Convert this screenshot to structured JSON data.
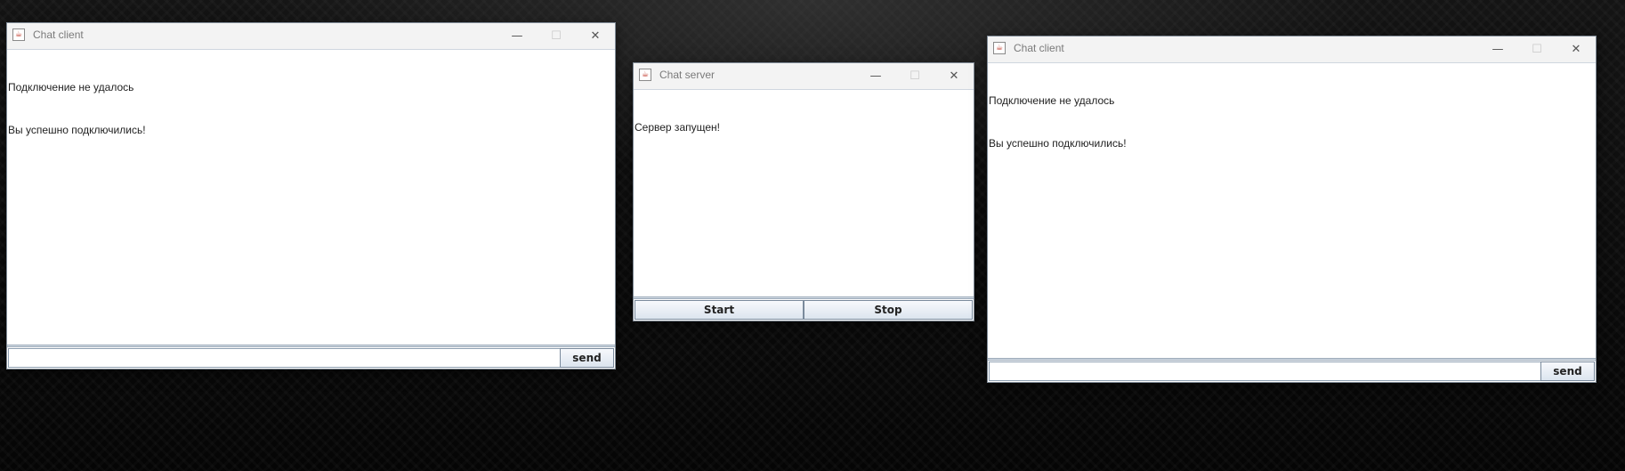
{
  "client_left": {
    "title": "Chat client",
    "messages": [
      "Подключение не удалось",
      "Вы успешно подключились!"
    ],
    "input_value": "",
    "send_label": "send"
  },
  "server": {
    "title": "Chat server",
    "messages": [
      "Сервер запущен!"
    ],
    "start_label": "Start",
    "stop_label": "Stop"
  },
  "client_right": {
    "title": "Chat client",
    "messages": [
      "Подключение не удалось",
      "Вы успешно подключились!"
    ],
    "input_value": "",
    "send_label": "send"
  },
  "controls": {
    "minimize_glyph": "—",
    "maximize_glyph": "☐",
    "close_glyph": "✕",
    "app_icon_glyph": "☕"
  }
}
